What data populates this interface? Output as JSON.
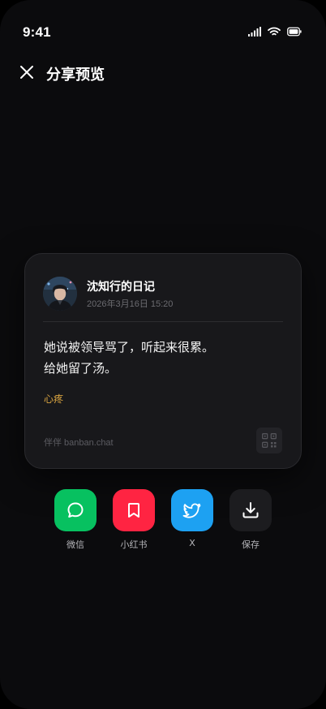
{
  "status_bar": {
    "time": "9:41"
  },
  "header": {
    "title": "分享预览",
    "close_icon": "close-icon"
  },
  "card": {
    "author": "沈知行的日记",
    "date": "2026年3月16日 15:20",
    "content": [
      "她说被领导骂了，听起来很累。",
      "给她留了汤。"
    ],
    "mood": "心疼",
    "brand": "伴伴 banban.chat",
    "colors": {
      "background": "#18181b",
      "mood": "#d9a441"
    }
  },
  "share_targets": [
    {
      "label": "微信",
      "icon": "wechat-icon",
      "color": "#07c160"
    },
    {
      "label": "小红书",
      "icon": "xiaohongshu-icon",
      "color": "#ff2442"
    },
    {
      "label": "X",
      "icon": "twitter-bird-icon",
      "color": "#1da1f2"
    },
    {
      "label": "保存",
      "icon": "download-icon",
      "color": "#1c1c1f"
    }
  ]
}
